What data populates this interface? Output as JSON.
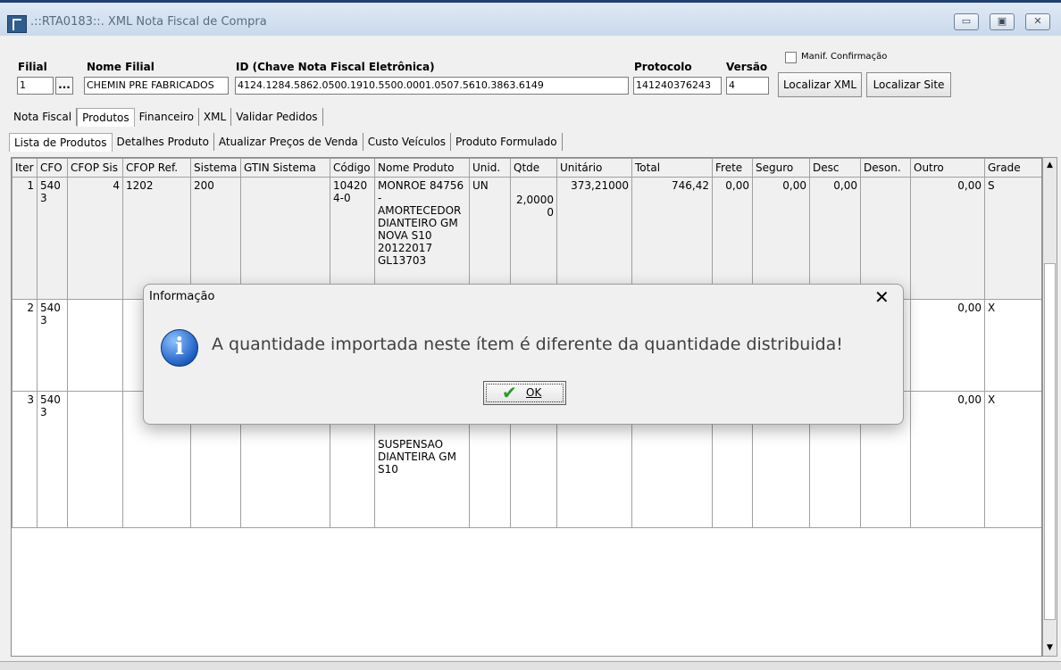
{
  "window": {
    "title": ".::RTA0183::. XML Nota Fiscal de Compra",
    "minimize": "▭",
    "maximize": "▣",
    "close": "✕"
  },
  "header": {
    "filial_label": "Filial",
    "nome_filial_label": "Nome Filial",
    "id_label": "ID (Chave Nota Fiscal Eletrônica)",
    "protocolo_label": "Protocolo",
    "versao_label": "Versão",
    "filial_value": "1",
    "lookup_button": "...",
    "nome_filial_value": "CHEMIN PRE FABRICADOS",
    "id_value": "4124.1284.5862.0500.1910.5500.0001.0507.5610.3863.6149",
    "protocolo_value": "141240376243",
    "versao_value": "4",
    "manif_label": "Manif. Confirmação",
    "localizar_xml": "Localizar XML",
    "localizar_site": "Localizar Site"
  },
  "tabs": [
    "Nota Fiscal",
    "Produtos",
    "Financeiro",
    "XML",
    "Validar Pedidos"
  ],
  "subtabs": [
    "Lista de Produtos",
    "Detalhes Produto",
    "Atualizar Preços de Venda",
    "Custo Veículos",
    "Produto Formulado"
  ],
  "table": {
    "columns": [
      "Iter",
      "CFO",
      "CFOP Sis",
      "CFOP Ref.",
      "Sistema",
      "GTIN Sistema",
      "Código",
      "Nome Produto",
      "Unid.",
      "Qtde",
      "Unitário",
      "Total",
      "Frete",
      "Seguro",
      "Desc",
      "Deson.",
      "Outro",
      "Grade"
    ],
    "rows": [
      {
        "iter": "1",
        "cfo": "5403",
        "cfop_sis": "4",
        "cfop_ref": "1202",
        "sistema": "200",
        "gtin": "",
        "codigo": "104204-0",
        "nome": "MONROE 84756 - AMORTECEDOR DIANTEIRO GM NOVA S10 20122017 GL13703",
        "unid": "UN",
        "qtde": "2,00000",
        "unitario": "373,21000",
        "total": "746,42",
        "frete": "0,00",
        "seguro": "0,00",
        "desc": "0,00",
        "deson": "",
        "outro": "0,00",
        "grade": "S"
      },
      {
        "iter": "2",
        "cfo": "5403",
        "cfop_sis": "",
        "cfop_ref": "",
        "sistema": "",
        "gtin": "",
        "codigo": "",
        "nome": "",
        "unid": "",
        "qtde": "",
        "unitario": "",
        "total": "",
        "frete": "",
        "seguro": "",
        "desc": "",
        "deson": "",
        "outro": "0,00",
        "grade": "X"
      },
      {
        "iter": "3",
        "cfo": "5403",
        "cfop_sis": "",
        "cfop_ref": "",
        "sistema": "",
        "gtin": "",
        "codigo": "",
        "nome": "SUSPENSAO DIANTEIRA GM S10",
        "unid": "",
        "qtde": "",
        "unitario": "",
        "total": "",
        "frete": "",
        "seguro": "",
        "desc": "",
        "deson": "",
        "outro": "0,00",
        "grade": "X"
      }
    ]
  },
  "dialog": {
    "title": "Informação",
    "message": "A quantidade importada neste ítem é diferente da quantidade distribuida!",
    "ok": "OK",
    "close": "✕",
    "icon": "info-icon"
  }
}
